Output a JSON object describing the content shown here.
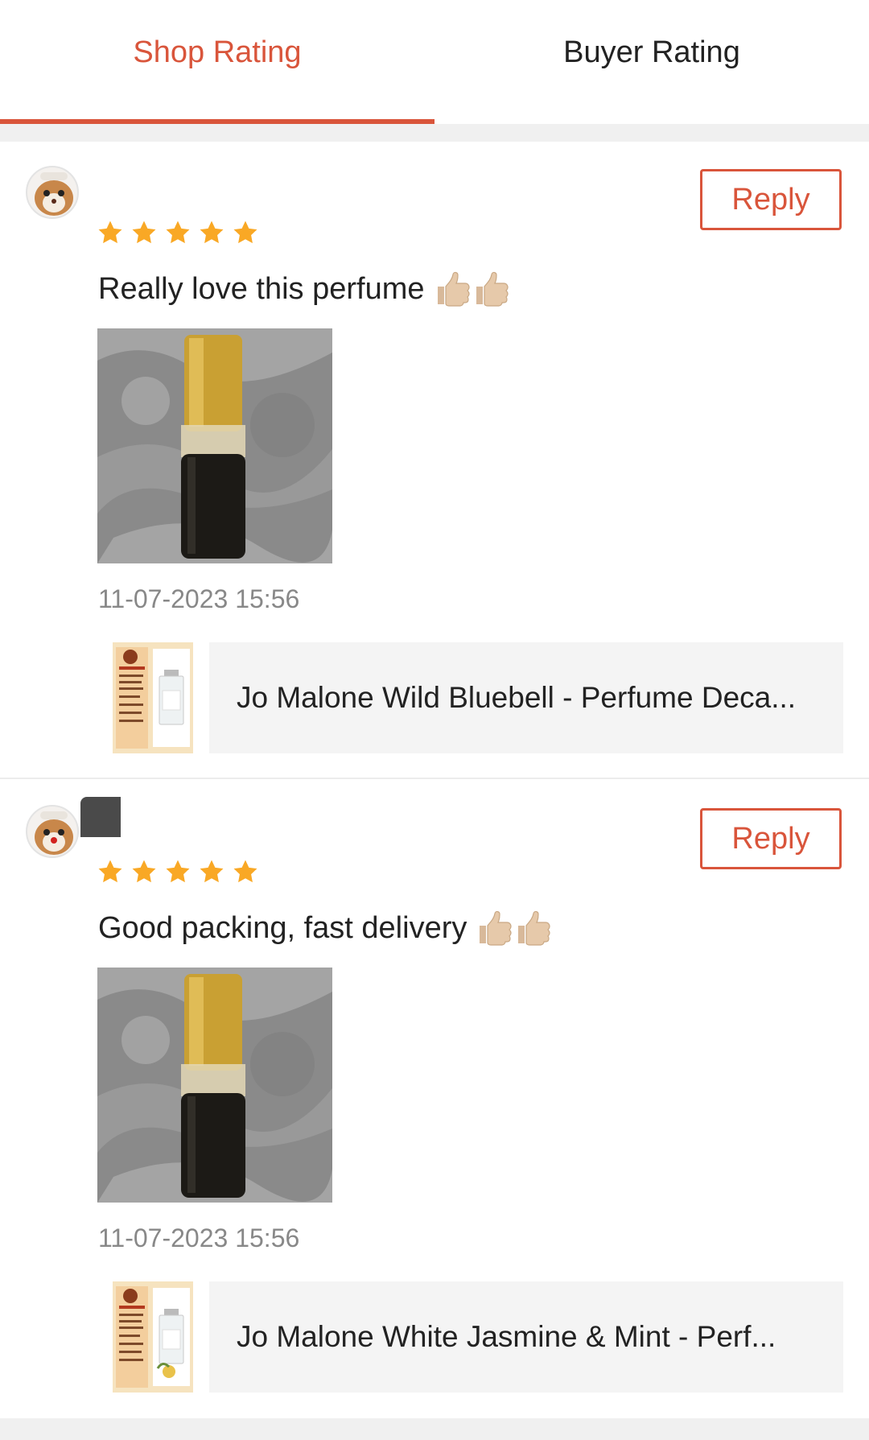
{
  "tabs": [
    {
      "label": "Shop Rating",
      "active": true
    },
    {
      "label": "Buyer Rating",
      "active": false
    }
  ],
  "colors": {
    "accent": "#d9553b",
    "star": "#f9a825"
  },
  "reviews": [
    {
      "rating": 5,
      "comment": "Really love this perfume",
      "emoji": "thumbs-up-icon",
      "timestamp": "11-07-2023 15:56",
      "reply_label": "Reply",
      "product_name": "Jo Malone Wild Bluebell - Perfume Deca..."
    },
    {
      "rating": 5,
      "comment": "Good packing, fast delivery",
      "emoji": "thumbs-up-icon",
      "timestamp": "11-07-2023 15:56",
      "reply_label": "Reply",
      "product_name": "Jo Malone White Jasmine & Mint - Perf..."
    }
  ]
}
